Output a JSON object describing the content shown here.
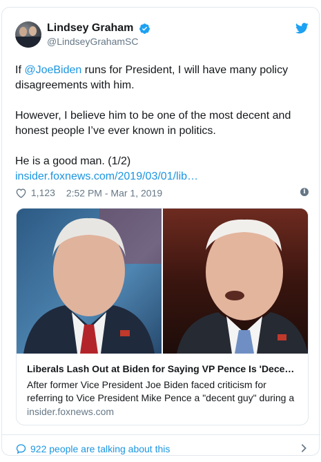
{
  "user": {
    "display_name": "Lindsey Graham",
    "handle": "@LindseyGrahamSC",
    "verified": true
  },
  "tweet": {
    "line1_prefix": "If ",
    "mention": "@JoeBiden",
    "line1_suffix": " runs for President, I will have many policy disagreements with him.",
    "para2": "However, I believe him to be one of the most decent and honest people I’ve ever known in politics.",
    "para3": "He is a good man.  (1/2)",
    "link": "insider.foxnews.com/2019/03/01/lib…"
  },
  "meta": {
    "likes": "1,123",
    "timestamp": "2:52 PM - Mar 1, 2019",
    "info_glyph": "i"
  },
  "card": {
    "title": "Liberals Lash Out at Biden for Saying VP Pence Is 'Dece…",
    "description": "After former Vice President Joe Biden faced criticism for referring to Vice President Mike Pence a \"decent guy\" during a",
    "domain": "insider.foxnews.com"
  },
  "footer": {
    "talking": "922 people are talking about this"
  },
  "colors": {
    "link": "#1b95e0",
    "muted": "#657786",
    "border": "#e1e8ed",
    "verified_badge": "#1da1f2"
  },
  "icons": [
    "twitter-bird-icon",
    "verified-icon",
    "heart-icon",
    "info-icon",
    "comment-bubble-icon",
    "chevron-right-icon"
  ]
}
